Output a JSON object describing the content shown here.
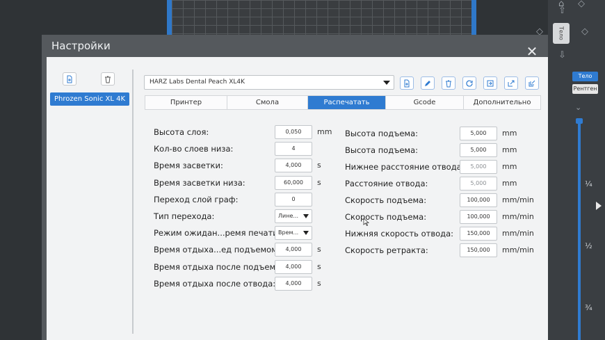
{
  "right_panel": {
    "tab_body": "Тело",
    "tab_xray": "Рентген",
    "tool_label": "Тело",
    "frac_quarter": "¼",
    "frac_half": "½",
    "frac_three_quarter": "¾"
  },
  "dialog": {
    "title": "Настройки",
    "close": "✕"
  },
  "printers": {
    "items": [
      "Phrozen Sonic XL 4K"
    ]
  },
  "profile": {
    "selected": "HARZ Labs Dental Peach XL4K"
  },
  "tabs": [
    "Принтер",
    "Смола",
    "Распечатать",
    "Gcode",
    "Дополнительно"
  ],
  "active_tab": "Распечатать",
  "left_settings": [
    {
      "label": "Высота слоя:",
      "value": "0,050",
      "unit": "mm"
    },
    {
      "label": "Кол-во слоев низа:",
      "value": "4",
      "unit": ""
    },
    {
      "label": "Время засветки:",
      "value": "4,000",
      "unit": "s"
    },
    {
      "label": "Время засветки низа:",
      "value": "60,000",
      "unit": "s"
    },
    {
      "label": "Переход слой граф:",
      "value": "0",
      "unit": ""
    },
    {
      "label": "Тип перехода:",
      "value": "Лине...",
      "unit": ""
    },
    {
      "label": "Режим ожидан...ремя печати:",
      "value": "Врем...",
      "unit": ""
    },
    {
      "label": "Время отдыха...ед подъемом:",
      "value": "4,000",
      "unit": "s"
    },
    {
      "label": "Время отдыха после подъема:",
      "value": "4,000",
      "unit": "s"
    },
    {
      "label": "Время отдыха после отвода:",
      "value": "4,000",
      "unit": "s"
    }
  ],
  "right_settings": [
    {
      "label": "Высота подъема:",
      "value": "5,000",
      "unit": "mm"
    },
    {
      "label": "Высота подъема:",
      "value": "5,000",
      "unit": "mm"
    },
    {
      "label": "Нижнее расстояние отвода:",
      "value": "5,000",
      "unit": "mm"
    },
    {
      "label": "Расстояние отвода:",
      "value": "5,000",
      "unit": "mm"
    },
    {
      "label": "Скорость подъема:",
      "value": "100,000",
      "unit": "mm/min"
    },
    {
      "label": "Скорость подъема:",
      "value": "100,000",
      "unit": "mm/min"
    },
    {
      "label": "Нижняя скорость отвода:",
      "value": "150,000",
      "unit": "mm/min"
    },
    {
      "label": "Скорость ретракта:",
      "value": "150,000",
      "unit": "mm/min"
    }
  ],
  "colors": {
    "accent": "#2f7bd1",
    "dialog_bg": "#55595d",
    "content_bg": "#f2f3f4"
  }
}
